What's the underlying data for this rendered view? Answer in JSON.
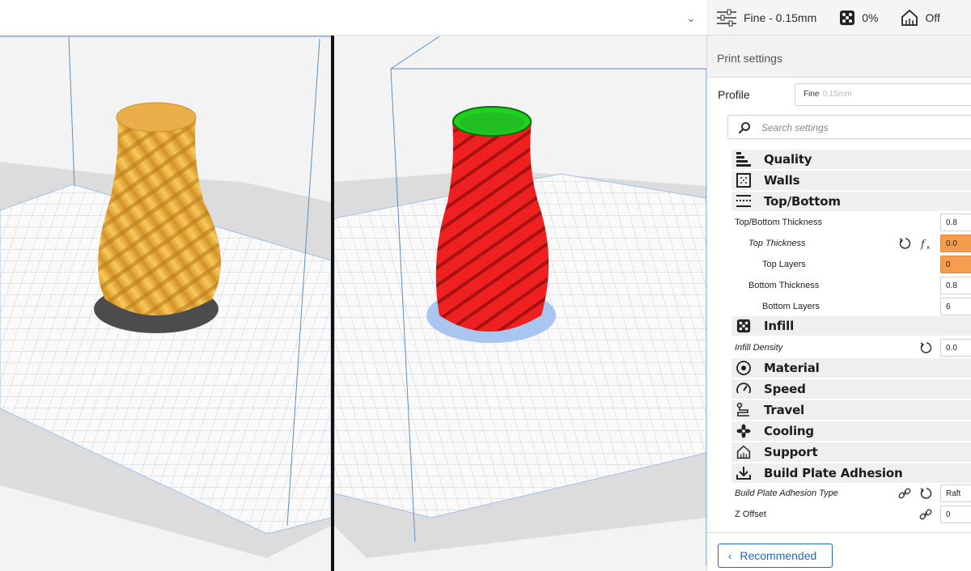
{
  "header": {
    "profile_label": "Fine - 0.15mm",
    "infill_label": "0%",
    "support_label": "Off",
    "dropdown_icon": "chevron-down-icon"
  },
  "panel": {
    "title": "Print settings",
    "profile_label": "Profile",
    "profile_value": "Fine",
    "profile_sub": "0.15mm",
    "search_placeholder": "Search settings",
    "recommended_label": "Recommended"
  },
  "categories": {
    "quality": "Quality",
    "walls": "Walls",
    "topbottom": "Top/Bottom",
    "infill": "Infill",
    "material": "Material",
    "speed": "Speed",
    "travel": "Travel",
    "cooling": "Cooling",
    "support": "Support",
    "adhesion": "Build Plate Adhesion"
  },
  "settings": {
    "tb_thickness": {
      "label": "Top/Bottom Thickness",
      "value": "0.8"
    },
    "top_thickness": {
      "label": "Top Thickness",
      "value": "0.0"
    },
    "top_layers": {
      "label": "Top Layers",
      "value": "0"
    },
    "bottom_thickness": {
      "label": "Bottom Thickness",
      "value": "0.8"
    },
    "bottom_layers": {
      "label": "Bottom Layers",
      "value": "6"
    },
    "infill_density": {
      "label": "Infill Density",
      "value": "0.0"
    },
    "adhesion_type": {
      "label": "Build Plate Adhesion Type",
      "value": "Raft"
    },
    "z_offset": {
      "label": "Z Offset",
      "value": "0"
    }
  },
  "colors": {
    "model_left": "#f2b94a",
    "model_right": "#e81c1c",
    "model_top_right": "#22d022",
    "warning": "#f59c4f",
    "accent": "#1e67c9"
  }
}
